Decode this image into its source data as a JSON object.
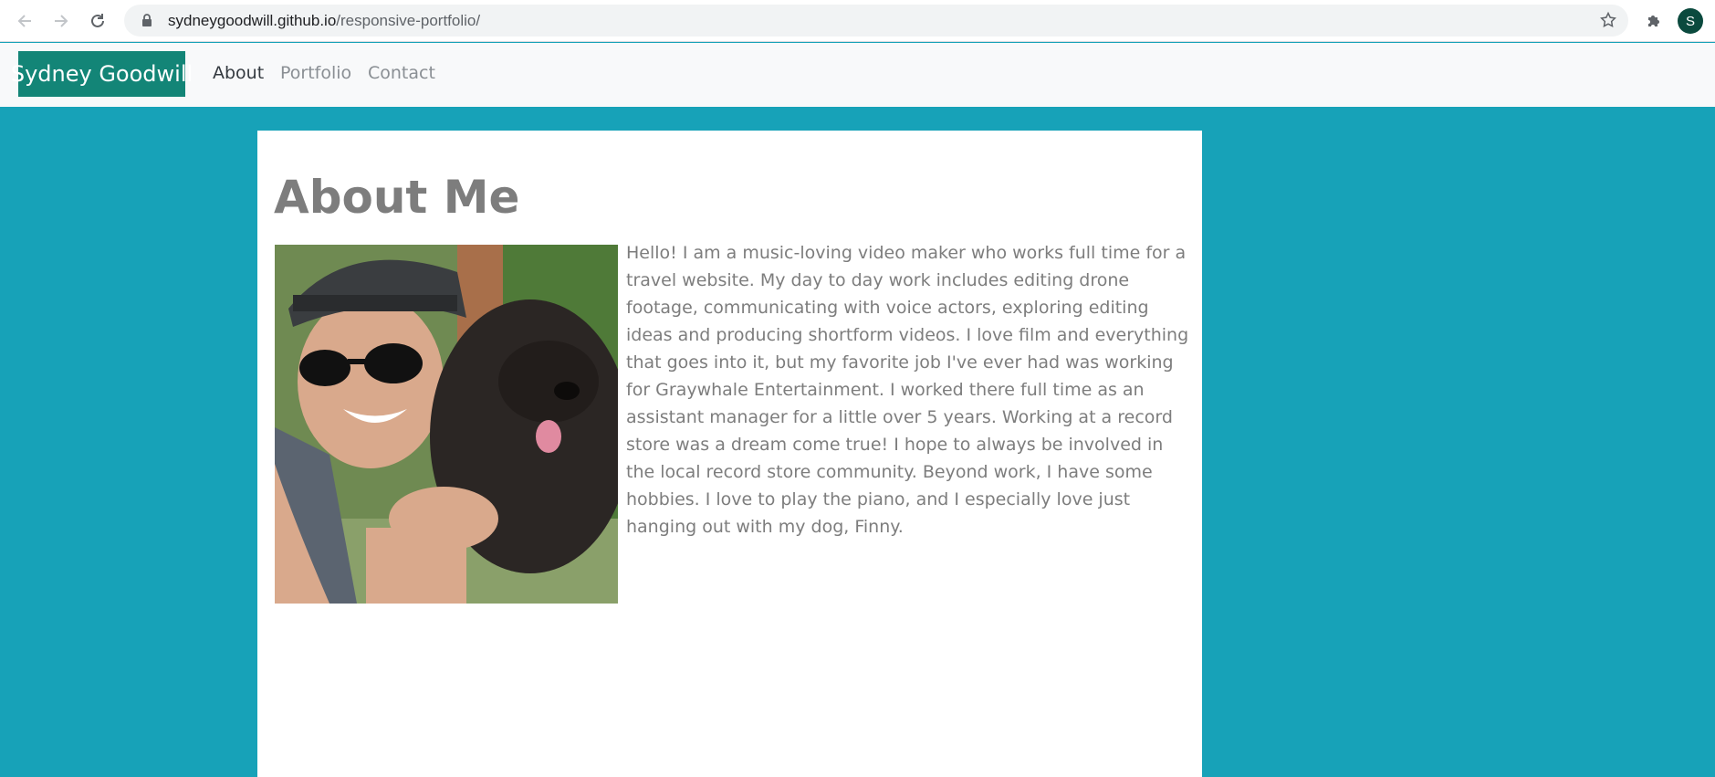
{
  "browser": {
    "url_host": "sydneygoodwill.github.io",
    "url_path": "/responsive-portfolio/",
    "profile_initial": "S"
  },
  "navbar": {
    "brand": "Sydney Goodwill",
    "links": [
      {
        "label": "About",
        "active": true
      },
      {
        "label": "Portfolio",
        "active": false
      },
      {
        "label": "Contact",
        "active": false
      }
    ]
  },
  "about": {
    "title": "About Me",
    "bio": "Hello! I am a music-loving video maker who works full time for a travel website. My day to day work includes editing drone footage, communicating with voice actors, exploring editing ideas and producing shortform videos. I love film and everything that goes into it, but my favorite job I've ever had was working for Graywhale Entertainment. I worked there full time as an assistant manager for a little over 5 years. Working at a record store was a dream come true! I hope to always be involved in the local record store community. Beyond work, I have some hobbies. I love to play the piano, and I especially love just hanging out with my dog, Finny."
  },
  "colors": {
    "page_background": "#17a2b8",
    "brand_background": "#138577",
    "text_muted": "#7d7d7d"
  }
}
